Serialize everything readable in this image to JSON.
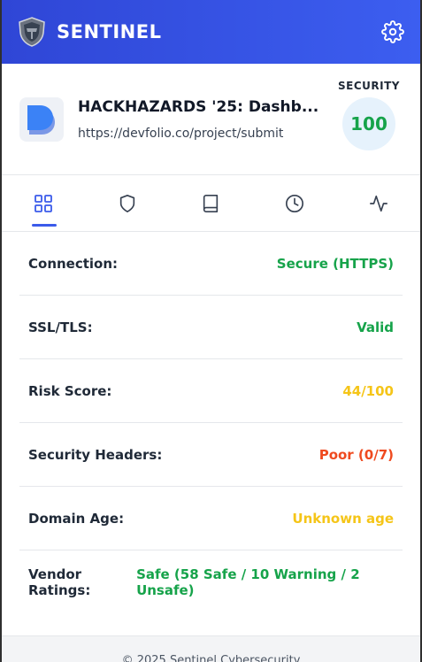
{
  "header": {
    "title": "SENTINEL",
    "logo_icon": "shield-knight-icon",
    "settings_icon": "gear-icon"
  },
  "site": {
    "title": "HACKHAZARDS '25: Dashb...",
    "url": "https://devfolio.co/project/submit",
    "favicon_icon": "devfolio-logo-icon",
    "security_label": "SECURITY",
    "security_score": "100"
  },
  "tabs": [
    {
      "icon": "grid-icon",
      "active": true
    },
    {
      "icon": "shield-icon",
      "active": false
    },
    {
      "icon": "book-icon",
      "active": false
    },
    {
      "icon": "clock-icon",
      "active": false
    },
    {
      "icon": "activity-icon",
      "active": false
    }
  ],
  "rows": [
    {
      "label": "Connection:",
      "value": "Secure (HTTPS)",
      "color": "#16a34a"
    },
    {
      "label": "SSL/TLS:",
      "value": "Valid",
      "color": "#16a34a"
    },
    {
      "label": "Risk Score:",
      "value": "44/100",
      "color": "#f5c518"
    },
    {
      "label": "Security Headers:",
      "value": "Poor (0/7)",
      "color": "#ef4a1f"
    },
    {
      "label": "Domain Age:",
      "value": "Unknown age",
      "color": "#f5c518"
    },
    {
      "label": "Vendor Ratings:",
      "value": "Safe (58 Safe / 10 Warning / 2 Unsafe)",
      "color": "#16a34a"
    }
  ],
  "footer": {
    "text": "© 2025 Sentinel Cybersecurity"
  },
  "colors": {
    "accent": "#3b5bea",
    "safe": "#16a34a",
    "warning": "#f5c518",
    "danger": "#ef4a1f"
  }
}
